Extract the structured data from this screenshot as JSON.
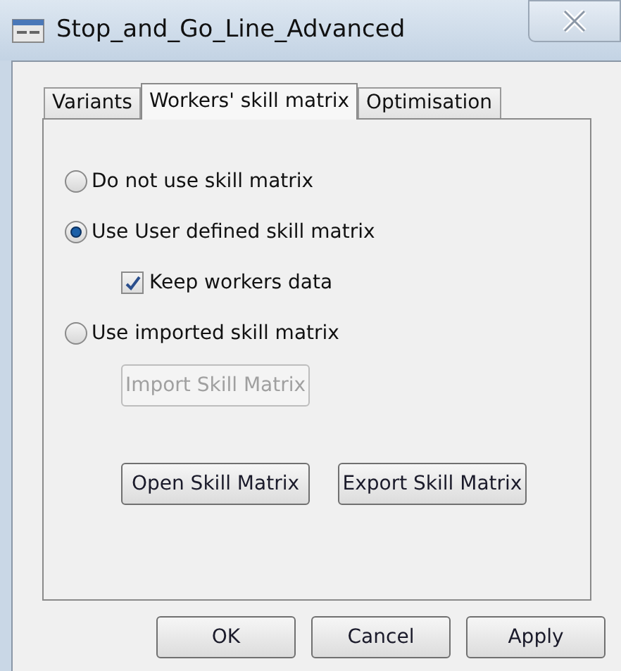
{
  "window": {
    "title": "Stop_and_Go_Line_Advanced"
  },
  "tabs": [
    {
      "label": "Variants",
      "selected": false
    },
    {
      "label": "Workers' skill matrix",
      "selected": true
    },
    {
      "label": "Optimisation",
      "selected": false
    }
  ],
  "options": [
    {
      "kind": "radio",
      "label": "Do not use skill matrix",
      "selected": false
    },
    {
      "kind": "radio",
      "label": "Use User defined skill matrix",
      "selected": true
    },
    {
      "kind": "checkbox",
      "label": "Keep workers data",
      "checked": true
    },
    {
      "kind": "radio",
      "label": "Use imported skill matrix",
      "selected": false
    },
    {
      "kind": "button",
      "label": "Import Skill Matrix",
      "disabled": true
    }
  ],
  "matrix_buttons": [
    "Open Skill Matrix",
    "Export Skill Matrix"
  ],
  "dialog_buttons": [
    "OK",
    "Cancel",
    "Apply"
  ]
}
